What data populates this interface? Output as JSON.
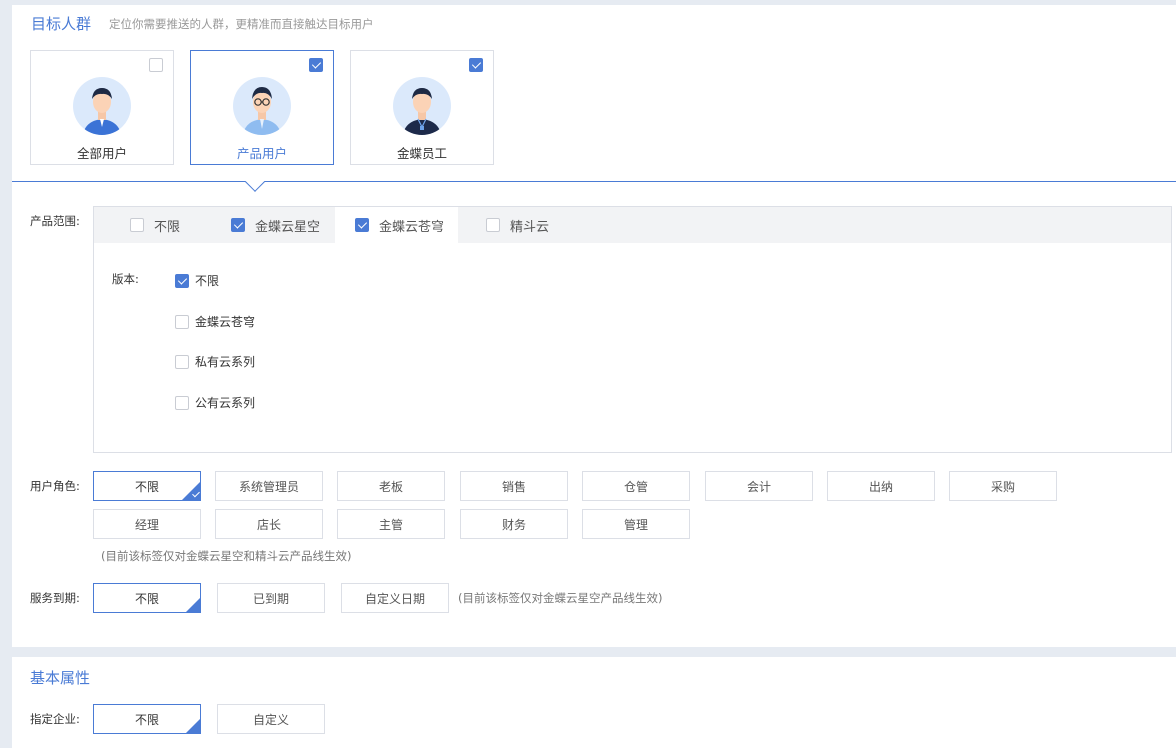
{
  "target": {
    "title": "目标人群",
    "subtitle": "定位你需要推送的人群，更精准而直接触达目标用户",
    "audiences": [
      {
        "label": "全部用户",
        "checked": false,
        "selected": false
      },
      {
        "label": "产品用户",
        "checked": true,
        "selected": true
      },
      {
        "label": "金蝶员工",
        "checked": true,
        "selected": false
      }
    ],
    "product": {
      "label": "产品范围:",
      "tabs": [
        {
          "label": "不限",
          "checked": false
        },
        {
          "label": "金蝶云星空",
          "checked": true
        },
        {
          "label": "金蝶云苍穹",
          "checked": true
        },
        {
          "label": "精斗云",
          "checked": false
        }
      ],
      "version_label": "版本:",
      "versions": [
        {
          "label": "不限",
          "checked": true
        },
        {
          "label": "金蝶云苍穹",
          "checked": false
        },
        {
          "label": "私有云系列",
          "checked": false
        },
        {
          "label": "公有云系列",
          "checked": false
        }
      ]
    },
    "roles": {
      "label": "用户角色:",
      "row1": [
        "不限",
        "系统管理员",
        "老板",
        "销售",
        "仓管",
        "会计",
        "出纳",
        "采购"
      ],
      "row2": [
        "经理",
        "店长",
        "主管",
        "财务",
        "管理"
      ],
      "note": "(目前该标签仅对金蝶云星空和精斗云产品线生效)"
    },
    "service": {
      "label": "服务到期:",
      "options": [
        "不限",
        "已到期",
        "自定义日期"
      ],
      "note": "(目前该标签仅对金蝶云星空产品线生效)"
    }
  },
  "basic": {
    "title": "基本属性",
    "company_label": "指定企业:",
    "options": [
      "不限",
      "自定义"
    ]
  },
  "colors": {
    "accent": "#4a7bd5",
    "avatar_bg": "#dbe9fb"
  }
}
